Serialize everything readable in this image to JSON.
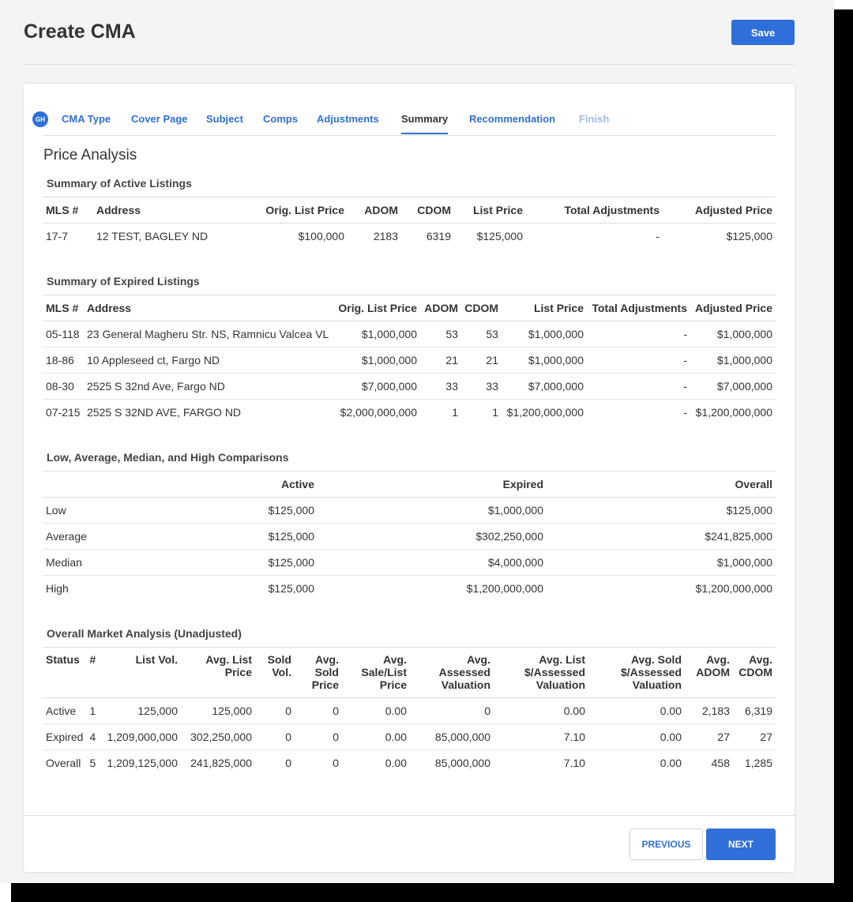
{
  "header": {
    "title": "Create CMA",
    "save_label": "Save"
  },
  "wizard": {
    "avatar_initials": "GH",
    "tabs": [
      {
        "label": "CMA Type",
        "state": "link"
      },
      {
        "label": "Cover Page",
        "state": "link"
      },
      {
        "label": "Subject",
        "state": "link"
      },
      {
        "label": "Comps",
        "state": "link"
      },
      {
        "label": "Adjustments",
        "state": "link"
      },
      {
        "label": "Summary",
        "state": "active"
      },
      {
        "label": "Recommendation",
        "state": "link"
      },
      {
        "label": "Finish",
        "state": "disabled"
      }
    ]
  },
  "section_title": "Price Analysis",
  "active": {
    "caption": "Summary of Active Listings",
    "headers": [
      "MLS #",
      "Address",
      "Orig. List Price",
      "ADOM",
      "CDOM",
      "List Price",
      "Total Adjustments",
      "Adjusted Price"
    ],
    "rows": [
      [
        "17-7",
        "12 TEST, BAGLEY ND",
        "$100,000",
        "2183",
        "6319",
        "$125,000",
        "-",
        "$125,000"
      ]
    ]
  },
  "expired": {
    "caption": "Summary of Expired Listings",
    "headers": [
      "MLS #",
      "Address",
      "Orig. List Price",
      "ADOM",
      "CDOM",
      "List Price",
      "Total Adjustments",
      "Adjusted Price"
    ],
    "rows": [
      [
        "05-118",
        "23 General Magheru Str. NS, Ramnicu Valcea VL",
        "$1,000,000",
        "53",
        "53",
        "$1,000,000",
        "-",
        "$1,000,000"
      ],
      [
        "18-86",
        "10 Appleseed ct, Fargo ND",
        "$1,000,000",
        "21",
        "21",
        "$1,000,000",
        "-",
        "$1,000,000"
      ],
      [
        "08-30",
        "2525 S 32nd Ave, Fargo ND",
        "$7,000,000",
        "33",
        "33",
        "$7,000,000",
        "-",
        "$7,000,000"
      ],
      [
        "07-215",
        "2525 S 32ND AVE, FARGO ND",
        "$2,000,000,000",
        "1",
        "1",
        "$1,200,000,000",
        "-",
        "$1,200,000,000"
      ]
    ]
  },
  "comparisons": {
    "caption": "Low, Average, Median, and High Comparisons",
    "headers": [
      "",
      "Active",
      "Expired",
      "Overall"
    ],
    "rows": [
      [
        "Low",
        "$125,000",
        "$1,000,000",
        "$125,000"
      ],
      [
        "Average",
        "$125,000",
        "$302,250,000",
        "$241,825,000"
      ],
      [
        "Median",
        "$125,000",
        "$4,000,000",
        "$1,000,000"
      ],
      [
        "High",
        "$125,000",
        "$1,200,000,000",
        "$1,200,000,000"
      ]
    ]
  },
  "market": {
    "caption": "Overall Market Analysis (Unadjusted)",
    "headers": [
      "Status",
      "#",
      "List Vol.",
      "Avg. List Price",
      "Sold Vol.",
      "Avg. Sold Price",
      "Avg. Sale/List Price",
      "Avg. Assessed Valuation",
      "Avg. List $/Assessed Valuation",
      "Avg. Sold $/Assessed Valuation",
      "Avg. ADOM",
      "Avg. CDOM"
    ],
    "rows": [
      [
        "Active",
        "1",
        "125,000",
        "125,000",
        "0",
        "0",
        "0.00",
        "0",
        "0.00",
        "0.00",
        "2,183",
        "6,319"
      ],
      [
        "Expired",
        "4",
        "1,209,000,000",
        "302,250,000",
        "0",
        "0",
        "0.00",
        "85,000,000",
        "7.10",
        "0.00",
        "27",
        "27"
      ],
      [
        "Overall",
        "5",
        "1,209,125,000",
        "241,825,000",
        "0",
        "0",
        "0.00",
        "85,000,000",
        "7.10",
        "0.00",
        "458",
        "1,285"
      ]
    ]
  },
  "footer": {
    "previous_label": "PREVIOUS",
    "next_label": "NEXT"
  }
}
